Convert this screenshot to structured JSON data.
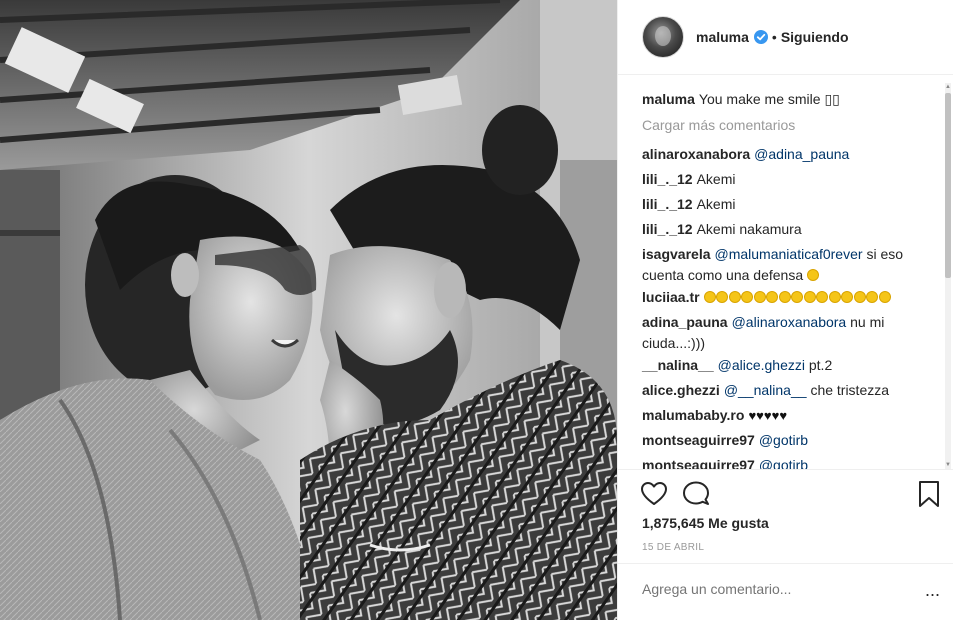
{
  "header": {
    "username": "maluma",
    "separator": "•",
    "follow_label": "Siguiendo"
  },
  "caption": {
    "username": "maluma",
    "text": "You make me smile ▯▯"
  },
  "load_more_label": "Cargar más comentarios",
  "comments": [
    {
      "user": "alinaroxanabora",
      "mention": "@adina_pauna",
      "text": ""
    },
    {
      "user": "lili_._12",
      "mention": "",
      "text": "Akemi"
    },
    {
      "user": "lili_._12",
      "mention": "",
      "text": "Akemi"
    },
    {
      "user": "lili_._12",
      "mention": "",
      "text": "Akemi nakamura"
    },
    {
      "user": "isagvarela",
      "mention": "@malumaniaticaf0rever",
      "text": "si eso",
      "text2": "cuenta como una defensa"
    },
    {
      "user": "luciiaa.tr",
      "mention": "",
      "text": ""
    },
    {
      "user": "adina_pauna",
      "mention": "@alinaroxanabora",
      "text": "nu mi",
      "text2": "ciuda...:)))"
    },
    {
      "user": "__nalina__",
      "mention": "@alice.ghezzi",
      "text": "pt.2"
    },
    {
      "user": "alice.ghezzi",
      "mention": "@__nalina__",
      "text": "che tristezza"
    },
    {
      "user": "malumababy.ro",
      "mention": "",
      "text": "♥♥♥♥♥"
    },
    {
      "user": "montseaguirre97",
      "mention": "@gotirb",
      "text": ""
    },
    {
      "user": "montseaguirre97",
      "mention": "@gotirb",
      "text": ""
    }
  ],
  "likes_label": "1,875,645 Me gusta",
  "date_label": "15 DE ABRIL",
  "add_comment_placeholder": "Agrega un comentario...",
  "more_label": "...",
  "icons": {
    "verified": "verified-badge-icon",
    "like": "heart-outline-icon",
    "comment": "speech-bubble-icon",
    "save": "bookmark-icon",
    "emoji": "grinning-face-icon"
  },
  "colors": {
    "text": "#262626",
    "muted": "#999999",
    "mention": "#003569",
    "verified": "#3897f0",
    "divider": "#efefef"
  }
}
